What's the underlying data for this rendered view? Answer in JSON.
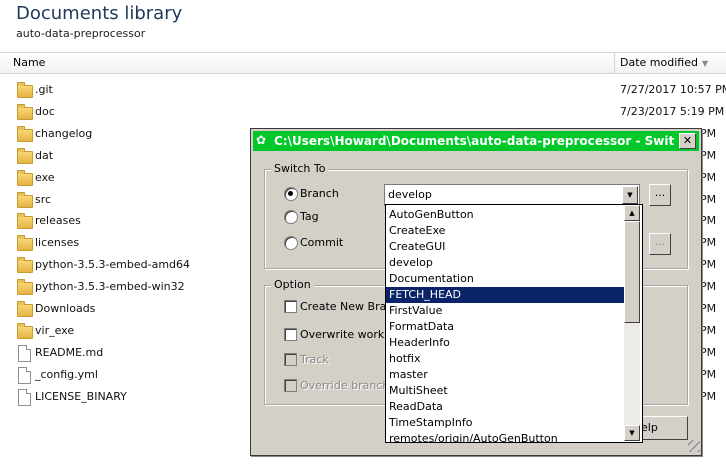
{
  "library": {
    "title": "Documents library",
    "subtitle": "auto-data-preprocessor",
    "columns": {
      "name": "Name",
      "date": "Date modified"
    }
  },
  "files": [
    {
      "name": ".git",
      "type": "folder",
      "date": "7/27/2017 10:57 PM"
    },
    {
      "name": "doc",
      "type": "folder",
      "date": "7/23/2017 5:19 PM"
    },
    {
      "name": "changelog",
      "type": "folder",
      "date": "PM"
    },
    {
      "name": "dat",
      "type": "folder",
      "date": "PM"
    },
    {
      "name": "exe",
      "type": "folder",
      "date": "PM"
    },
    {
      "name": "src",
      "type": "folder",
      "date": "PM"
    },
    {
      "name": "releases",
      "type": "folder",
      "date": "PM"
    },
    {
      "name": "licenses",
      "type": "folder",
      "date": "PM"
    },
    {
      "name": "python-3.5.3-embed-amd64",
      "type": "folder",
      "date": "PM"
    },
    {
      "name": "python-3.5.3-embed-win32",
      "type": "folder",
      "date": "PM"
    },
    {
      "name": "Downloads",
      "type": "folder",
      "date": "PM"
    },
    {
      "name": "vir_exe",
      "type": "folder",
      "date": "PM"
    },
    {
      "name": "README.md",
      "type": "file",
      "date": "PM"
    },
    {
      "name": "_config.yml",
      "type": "file",
      "date": "PM"
    },
    {
      "name": "LICENSE_BINARY",
      "type": "file",
      "date": "PM"
    }
  ],
  "dialog": {
    "title": "C:\\Users\\Howard\\Documents\\auto-data-preprocessor - Switch/Chec...",
    "title_color": "#00c82a",
    "close_label": "✕",
    "switch_group": "Switch To",
    "radio_branch": "Branch",
    "radio_tag": "Tag",
    "radio_commit": "Commit",
    "combo_value": "develop",
    "ellipsis": "...",
    "option_group": "Option",
    "opt_create": "Create New Branc",
    "opt_overwrite": "Overwrite working",
    "opt_track": "Track",
    "opt_override": "Override branch if",
    "help_label": "elp"
  },
  "dropdown": {
    "selected": "FETCH_HEAD",
    "items": [
      "AutoGenButton",
      "CreateExe",
      "CreateGUI",
      "develop",
      "Documentation",
      "FETCH_HEAD",
      "FirstValue",
      "FormatData",
      "HeaderInfo",
      "hotfix",
      "master",
      "MultiSheet",
      "ReadData",
      "TimeStampInfo",
      "remotes/origin/AutoGenButton"
    ]
  }
}
